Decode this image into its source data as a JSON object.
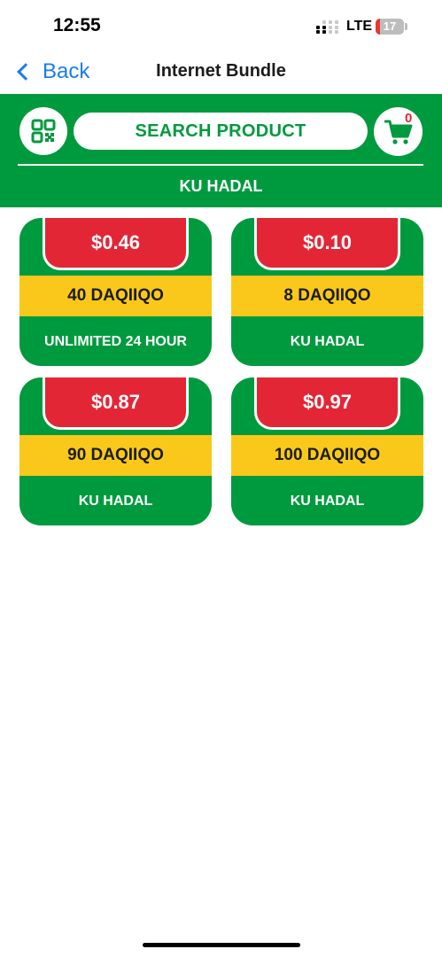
{
  "status_bar": {
    "time": "12:55",
    "network": "LTE",
    "battery_level": "17",
    "battery_fraction": 0.17,
    "battery_color": "#e53935"
  },
  "nav": {
    "back_label": "Back",
    "back_icon": "chevron-left-icon",
    "title": "Internet Bundle",
    "accent_color": "#1a7cf0"
  },
  "header": {
    "qr_icon": "qr-code-icon",
    "search_label": "SEARCH PRODUCT",
    "cart_icon": "cart-icon",
    "cart_count": "0",
    "category": "KU HADAL",
    "brand_color": "#009a3e"
  },
  "products": [
    {
      "price": "$0.46",
      "name": "40 DAQIIQO",
      "description": "UNLIMITED 24 HOUR"
    },
    {
      "price": "$0.10",
      "name": "8 DAQIIQO",
      "description": "KU HADAL"
    },
    {
      "price": "$0.87",
      "name": "90 DAQIIQO",
      "description": "KU HADAL"
    },
    {
      "price": "$0.97",
      "name": "100 DAQIIQO",
      "description": "KU HADAL"
    }
  ],
  "colors": {
    "price_tab": "#e32636",
    "name_band": "#f9c81a",
    "card": "#009a3e"
  }
}
